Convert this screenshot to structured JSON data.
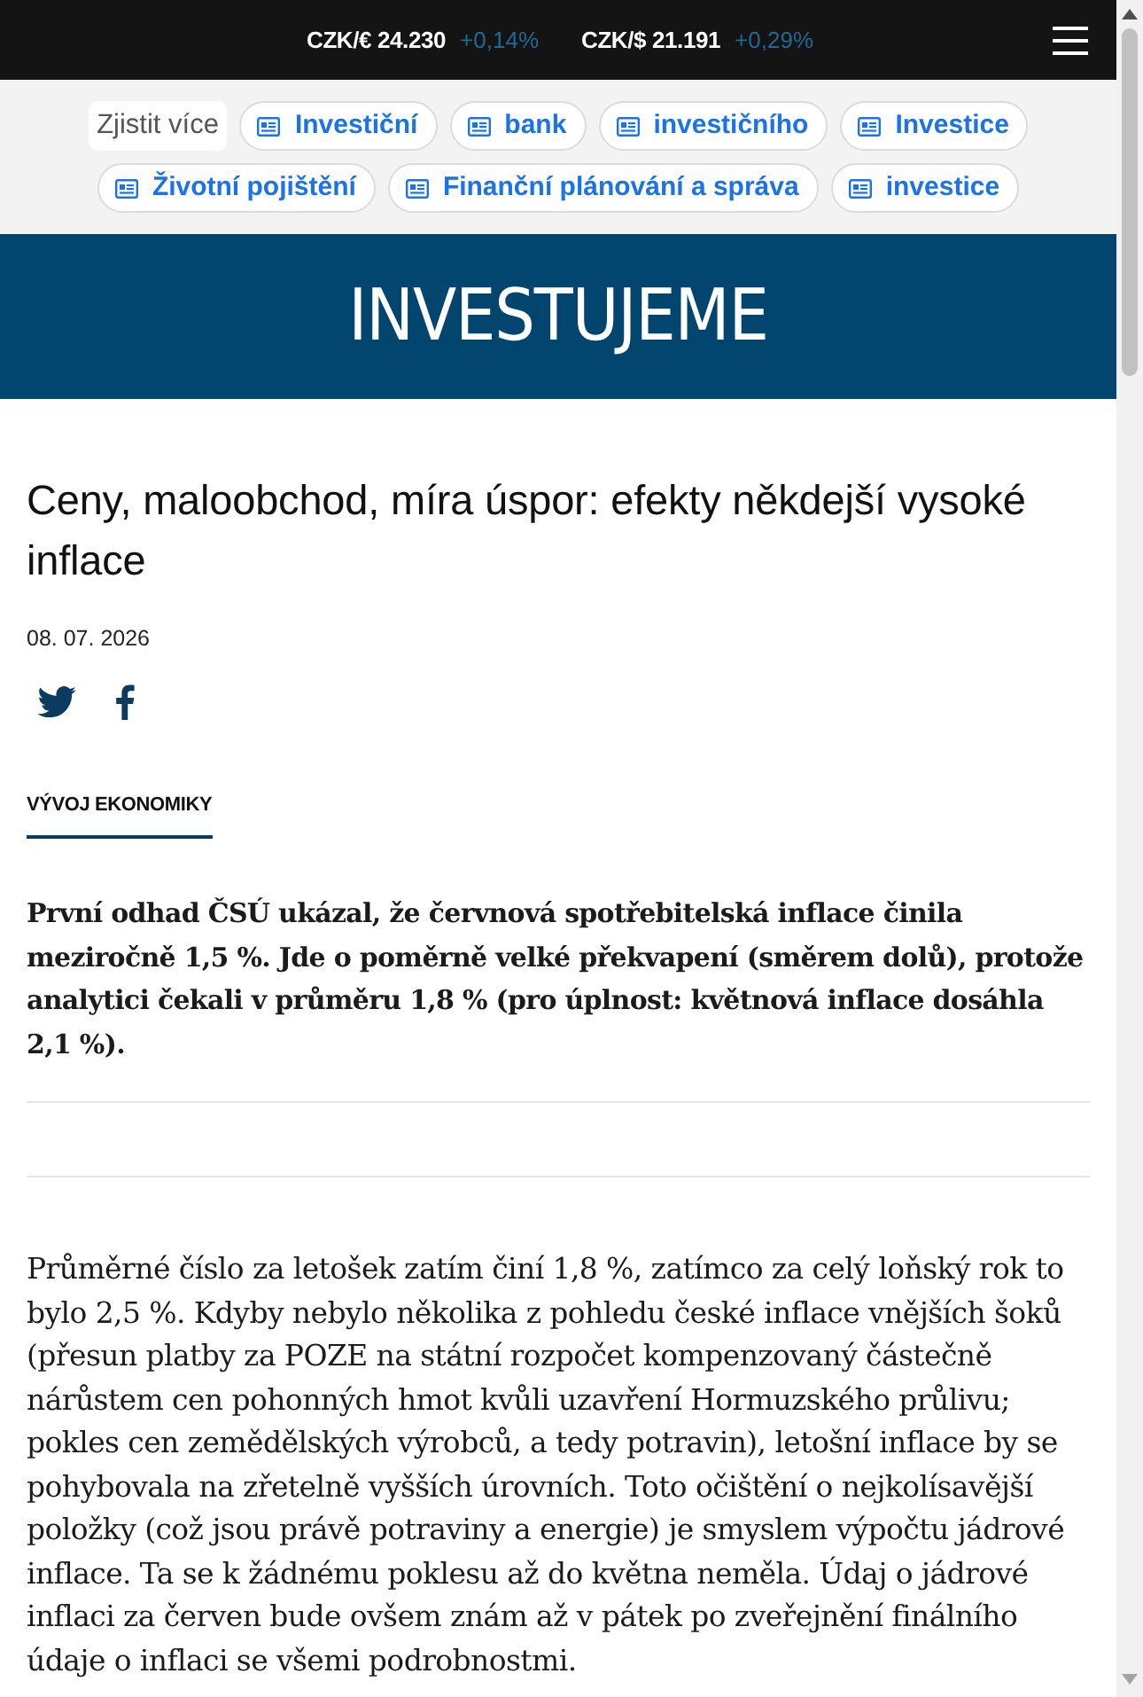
{
  "top_bar": {
    "rates": [
      {
        "rate": "CZK/€ 24.230",
        "change": "+0,14%"
      },
      {
        "rate": "CZK/$ 21.191",
        "change": "+0,29%"
      }
    ]
  },
  "topics": {
    "label": "Zjistit více",
    "tags": [
      "Investiční",
      "bank",
      "investičního",
      "Investice",
      "Životní pojištění",
      "Finanční plánování a správa",
      "investice"
    ]
  },
  "banner": {
    "logo": "INVESTUJEME"
  },
  "article": {
    "title": "Ceny, maloobchod, míra úspor: efekty někdejší vysoké inflace",
    "date": "08. 07. 2026",
    "category": "VÝVOJ EKONOMIKY",
    "lead": "První odhad ČSÚ ukázal, že červnová spotřebitelská inflace činila meziročně 1,5 %. Jde o poměrně velké překvapení (směrem dolů), protože analytici čekali v průměru 1,8 % (pro úplnost: květnová inflace dosáhla 2,1 %).",
    "body": [
      "Průměrné číslo za letošek zatím činí 1,8 %, zatímco za celý loňský rok to bylo 2,5 %. Kdyby nebylo několika z pohledu české inflace vnějších šoků (přesun platby za POZE na státní rozpočet kompenzovaný částečně nárůstem cen pohonných hmot kvůli uzavření Hormuzského průlivu; pokles cen zemědělských výrobců, a tedy potravin), letošní inflace by se pohybovala na zřetelně vyšších úrovních. Toto očištění o nejkolísavější položky (což jsou právě potraviny a energie) je smyslem výpočtu jádrové inflace. Ta se k žádnému poklesu až do května neměla. Údaj o jádrové inflaci za červen bude ovšem znám až v pátek po zveřejnění finálního údaje o inflaci se všemi podrobnostmi."
    ]
  }
}
